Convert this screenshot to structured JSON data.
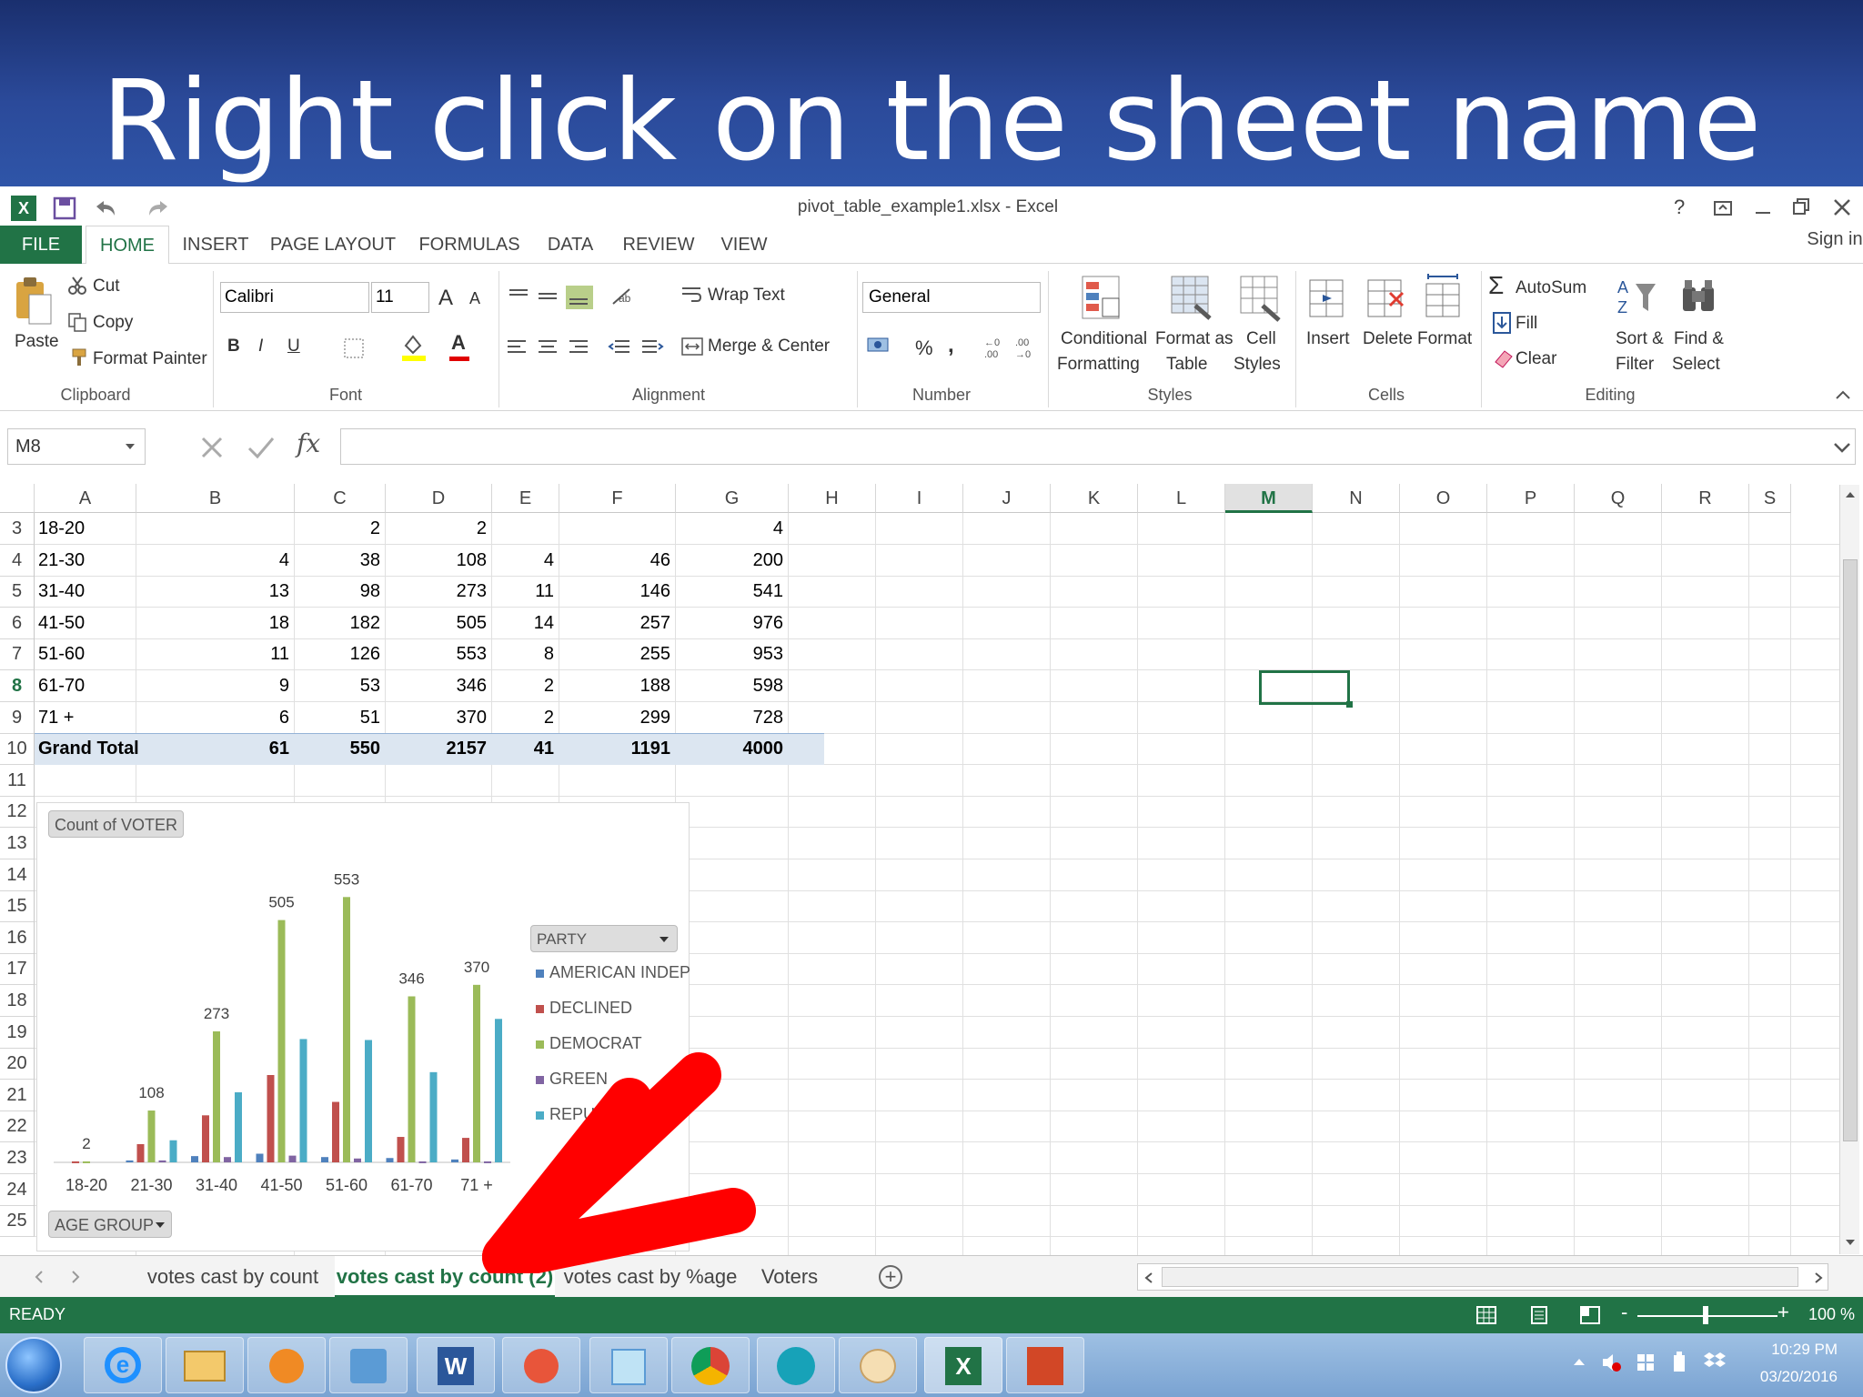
{
  "slide": {
    "title": "Right click on the sheet name"
  },
  "window": {
    "title": "pivot_table_example1.xlsx - Excel",
    "help": "?",
    "sign_in": "Sign in"
  },
  "ribbon": {
    "tabs": [
      "FILE",
      "HOME",
      "INSERT",
      "PAGE LAYOUT",
      "FORMULAS",
      "DATA",
      "REVIEW",
      "VIEW"
    ],
    "clipboard": {
      "paste": "Paste",
      "cut": "Cut",
      "copy": "Copy",
      "format_painter": "Format Painter",
      "group": "Clipboard"
    },
    "font": {
      "name": "Calibri",
      "size": "11",
      "bold": "B",
      "italic": "I",
      "underline": "U",
      "grow": "A",
      "shrink": "A",
      "color_letter": "A",
      "group": "Font"
    },
    "alignment": {
      "wrap_text": "Wrap Text",
      "merge_center": "Merge & Center",
      "group": "Alignment"
    },
    "number": {
      "format": "General",
      "percent": "%",
      "comma": ",",
      "group": "Number"
    },
    "styles": {
      "conditional": "Conditional",
      "conditional2": "Formatting",
      "format_as": "Format as",
      "format_as2": "Table",
      "cell": "Cell",
      "cell2": "Styles",
      "group": "Styles"
    },
    "cells": {
      "insert": "Insert",
      "delete": "Delete",
      "format": "Format",
      "group": "Cells"
    },
    "editing": {
      "autosum": "AutoSum",
      "fill": "Fill",
      "clear": "Clear",
      "sort": "Sort &",
      "sort2": "Filter",
      "find": "Find &",
      "find2": "Select",
      "group": "Editing"
    }
  },
  "formula_bar": {
    "name_box": "M8",
    "fx": "fx",
    "value": ""
  },
  "grid": {
    "columns": [
      "A",
      "B",
      "C",
      "D",
      "E",
      "F",
      "G",
      "H",
      "I",
      "J",
      "K",
      "L",
      "M",
      "N",
      "O",
      "P",
      "Q",
      "R",
      "S"
    ],
    "selected_column": "M",
    "row_numbers": [
      "3",
      "4",
      "5",
      "6",
      "7",
      "8",
      "9",
      "10",
      "11",
      "12",
      "13",
      "14",
      "15",
      "16",
      "17",
      "18",
      "19",
      "20",
      "21",
      "22",
      "23",
      "24",
      "25"
    ],
    "selected_row": "8",
    "rows": [
      [
        "18-20",
        "",
        "2",
        "2",
        "",
        "",
        "4"
      ],
      [
        "21-30",
        "4",
        "38",
        "108",
        "4",
        "46",
        "200"
      ],
      [
        "31-40",
        "13",
        "98",
        "273",
        "11",
        "146",
        "541"
      ],
      [
        "41-50",
        "18",
        "182",
        "505",
        "14",
        "257",
        "976"
      ],
      [
        "51-60",
        "11",
        "126",
        "553",
        "8",
        "255",
        "953"
      ],
      [
        "61-70",
        "9",
        "53",
        "346",
        "2",
        "188",
        "598"
      ],
      [
        "71 +",
        "6",
        "51",
        "370",
        "2",
        "299",
        "728"
      ],
      [
        "Grand Total",
        "61",
        "550",
        "2157",
        "41",
        "1191",
        "4000"
      ]
    ]
  },
  "pivot_chart": {
    "value_button": "Count of VOTER",
    "axis_button": "AGE GROUP",
    "legend_button": "PARTY",
    "legend": [
      "AMERICAN INDEP",
      "DECLINED",
      "DEMOCRAT",
      "GREEN",
      "REPUBLICAN"
    ],
    "colors": [
      "#4f81bd",
      "#c0504d",
      "#9bbb59",
      "#8064a2",
      "#4bacc6"
    ]
  },
  "chart_data": {
    "type": "bar",
    "categories": [
      "18-20",
      "21-30",
      "31-40",
      "41-50",
      "51-60",
      "61-70",
      "71 +"
    ],
    "series": [
      {
        "name": "AMERICAN INDEP",
        "values": [
          0,
          4,
          13,
          18,
          11,
          9,
          6
        ]
      },
      {
        "name": "DECLINED",
        "values": [
          2,
          38,
          98,
          182,
          126,
          53,
          51
        ]
      },
      {
        "name": "DEMOCRAT",
        "values": [
          2,
          108,
          273,
          505,
          553,
          346,
          370
        ]
      },
      {
        "name": "GREEN",
        "values": [
          0,
          4,
          11,
          14,
          8,
          2,
          2
        ]
      },
      {
        "name": "REPUBLICAN",
        "values": [
          0,
          46,
          146,
          257,
          255,
          188,
          299
        ]
      }
    ],
    "data_labels": {
      "series": "DEMOCRAT",
      "values": [
        "2",
        "108",
        "273",
        "505",
        "553",
        "346",
        "370"
      ]
    },
    "ylim": [
      0,
      600
    ],
    "grid": false,
    "legend_position": "right"
  },
  "sheet_tabs": {
    "tabs": [
      "votes cast by count",
      "votes cast by count (2)",
      "votes cast by %age",
      "Voters"
    ],
    "active": "votes cast by count (2)",
    "add": "+"
  },
  "status_bar": {
    "ready": "READY",
    "zoom": "100 %",
    "minus": "-",
    "plus": "+"
  },
  "taskbar": {
    "time": "10:29 PM",
    "date": "03/20/2016"
  },
  "annotation": {
    "arrow_color": "#ff0000"
  }
}
